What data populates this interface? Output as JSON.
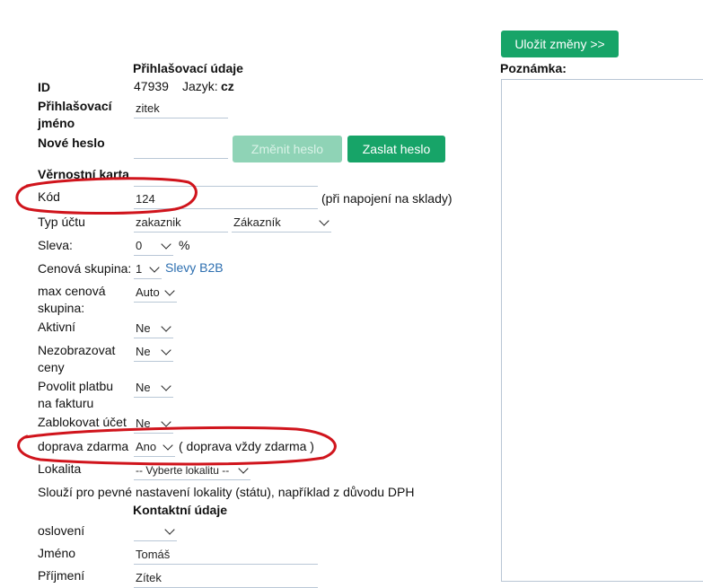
{
  "toolbar": {
    "save_label": "Uložit změny >>"
  },
  "note": {
    "label": "Poznámka:"
  },
  "login_section": {
    "heading": "Přihlašovací údaje",
    "id_label": "ID",
    "id_value": "47939",
    "lang_label": "Jazyk:",
    "lang_value": "cz",
    "username_label_line1": "Přihlašovací",
    "username_label_line2": "jméno",
    "username_value": "zitek",
    "new_password_label": "Nové heslo",
    "new_password_value": "",
    "change_password_label": "Změnit heslo",
    "send_password_label": "Zaslat heslo"
  },
  "loyalty_section": {
    "heading": "Věrnostní karta",
    "card_value": ""
  },
  "code": {
    "label": "Kód",
    "value": "124",
    "hint": "(při napojení na sklady)"
  },
  "account_type": {
    "label": "Typ účtu",
    "value": "zakaznik",
    "select_value": "Zákazník"
  },
  "discount": {
    "label": "Sleva:",
    "value": "0",
    "unit": "%"
  },
  "price_group": {
    "label": "Cenová skupina:",
    "value": "1",
    "link": "Slevy B2B"
  },
  "max_price_group": {
    "label_line1": "max cenová",
    "label_line2": "skupina:",
    "value": "Auto"
  },
  "active": {
    "label": "Aktivní",
    "value": "Ne"
  },
  "hide_prices": {
    "label_line1": "Nezobrazovat",
    "label_line2": "ceny",
    "value": "Ne"
  },
  "invoice_payment": {
    "label_line1": "Povolit platbu",
    "label_line2": "na fakturu",
    "value": "Ne"
  },
  "block_account": {
    "label": "Zablokovat účet",
    "value": "Ne"
  },
  "free_shipping": {
    "label": "doprava zdarma",
    "value": "Ano",
    "hint": "( doprava vždy zdarma )"
  },
  "locality": {
    "label": "Lokalita",
    "value": "-- Vyberte lokalitu --",
    "help": "Slouží pro pevné nastavení lokality (státu), například z důvodu DPH"
  },
  "contact_section": {
    "heading": "Kontaktní údaje",
    "salutation_label": "oslovení",
    "salutation_value": "",
    "first_name_label": "Jméno",
    "first_name_value": "Tomáš",
    "last_name_label": "Příjmení",
    "last_name_value": "Zítek"
  },
  "colors": {
    "accent": "#17a468",
    "accent_disabled": "#8fd3b6",
    "annotation": "#d0141c",
    "link": "#2d6fb0"
  },
  "icons": {
    "select_arrow": "chevron-down-icon"
  }
}
